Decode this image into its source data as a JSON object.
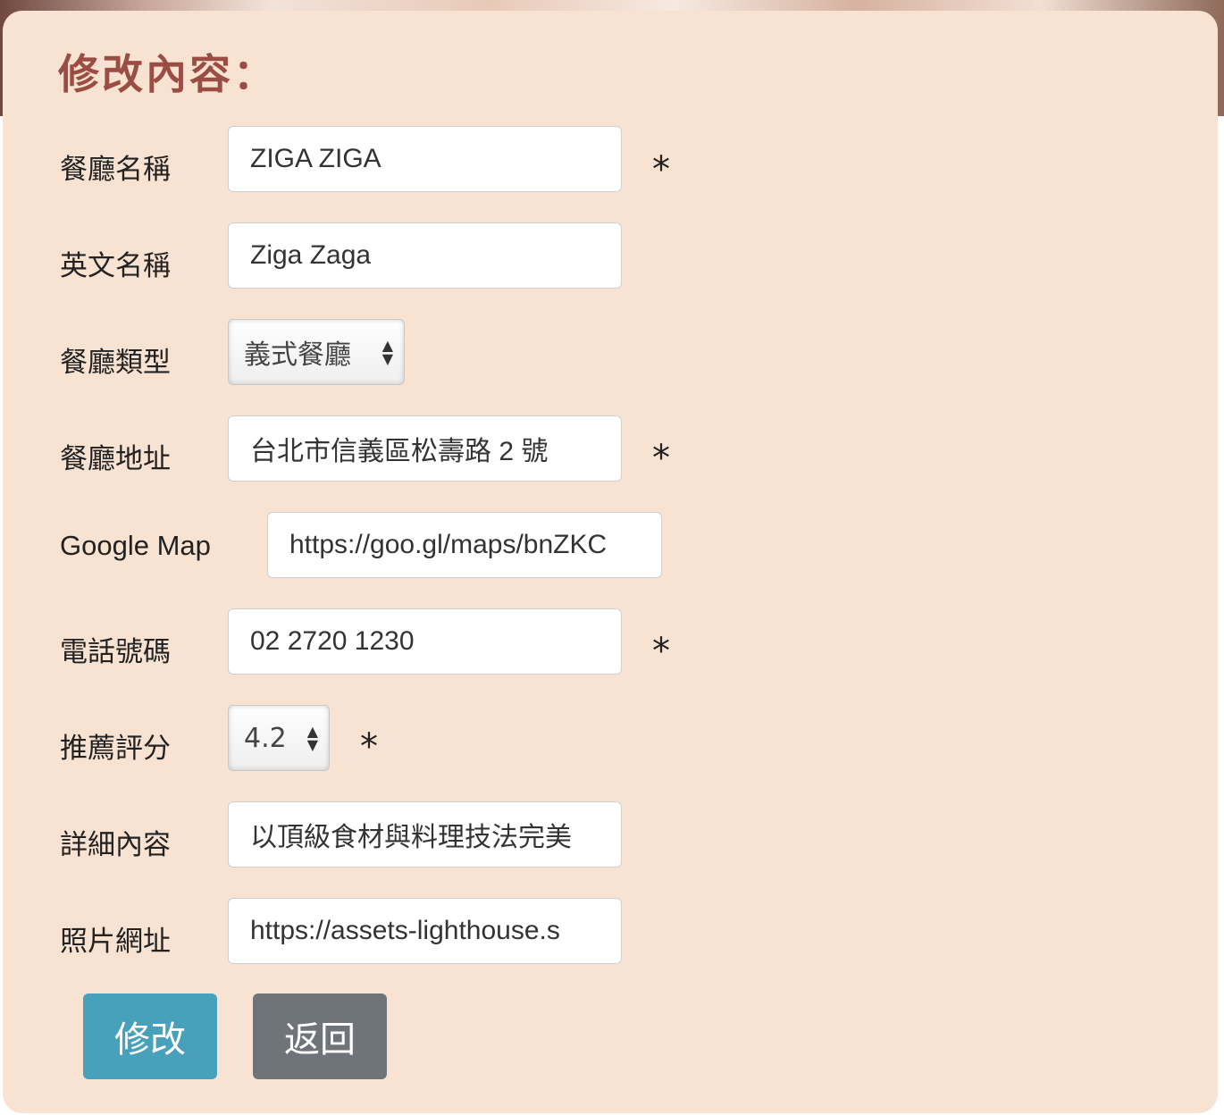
{
  "form": {
    "title": "修改內容：",
    "required_mark": "*",
    "fields": {
      "name": {
        "label": "餐廳名稱",
        "value": "ZIGA ZIGA"
      },
      "name_en": {
        "label": "英文名稱",
        "value": "Ziga Zaga"
      },
      "category": {
        "label": "餐廳類型",
        "value": "義式餐廳"
      },
      "address": {
        "label": "餐廳地址",
        "value": "台北市信義區松壽路 2 號"
      },
      "google_map": {
        "label": "Google Map",
        "value": "https://goo.gl/maps/bnZKC"
      },
      "phone": {
        "label": "電話號碼",
        "value": "02 2720 1230"
      },
      "rating": {
        "label": "推薦評分",
        "value": "4.2"
      },
      "description": {
        "label": "詳細內容",
        "value": "以頂級食材與料理技法完美"
      },
      "image": {
        "label": "照片網址",
        "value": "https://assets-lighthouse.s"
      }
    },
    "buttons": {
      "submit": "修改",
      "back": "返回"
    }
  }
}
